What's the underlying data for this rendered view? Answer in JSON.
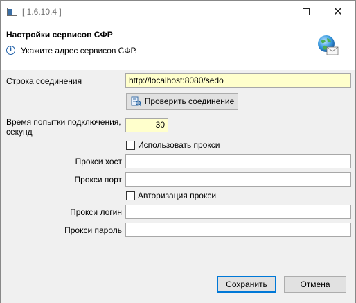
{
  "window": {
    "title": "[ 1.6.10.4 ]",
    "minimize_icon": "minimize-icon",
    "maximize_icon": "maximize-icon",
    "close_icon": "close-icon"
  },
  "header": {
    "title": "Настройки сервисов СФР",
    "message": "Укажите адрес сервисов СФР.",
    "info_icon": "info-icon",
    "logo_icon": "globe-mail-icon"
  },
  "form": {
    "connection_label": "Строка соединения",
    "connection_value": "http://localhost:8080/sedo",
    "check_button": "Проверить соединение",
    "timeout_label_line1": "Время попытки подключения,",
    "timeout_label_line2": "секунд",
    "timeout_value": "30",
    "use_proxy_label": "Использовать прокси",
    "proxy_host_label": "Прокси хост",
    "proxy_host_value": "",
    "proxy_port_label": "Прокси порт",
    "proxy_port_value": "",
    "proxy_auth_label": "Авторизация прокси",
    "proxy_login_label": "Прокси логин",
    "proxy_login_value": "",
    "proxy_password_label": "Прокси пароль",
    "proxy_password_value": ""
  },
  "footer": {
    "save_button": "Сохранить",
    "cancel_button": "Отмена"
  },
  "colors": {
    "accent": "#0078d7",
    "required_field": "#ffffcc",
    "body_bg": "#f0f0f0"
  }
}
